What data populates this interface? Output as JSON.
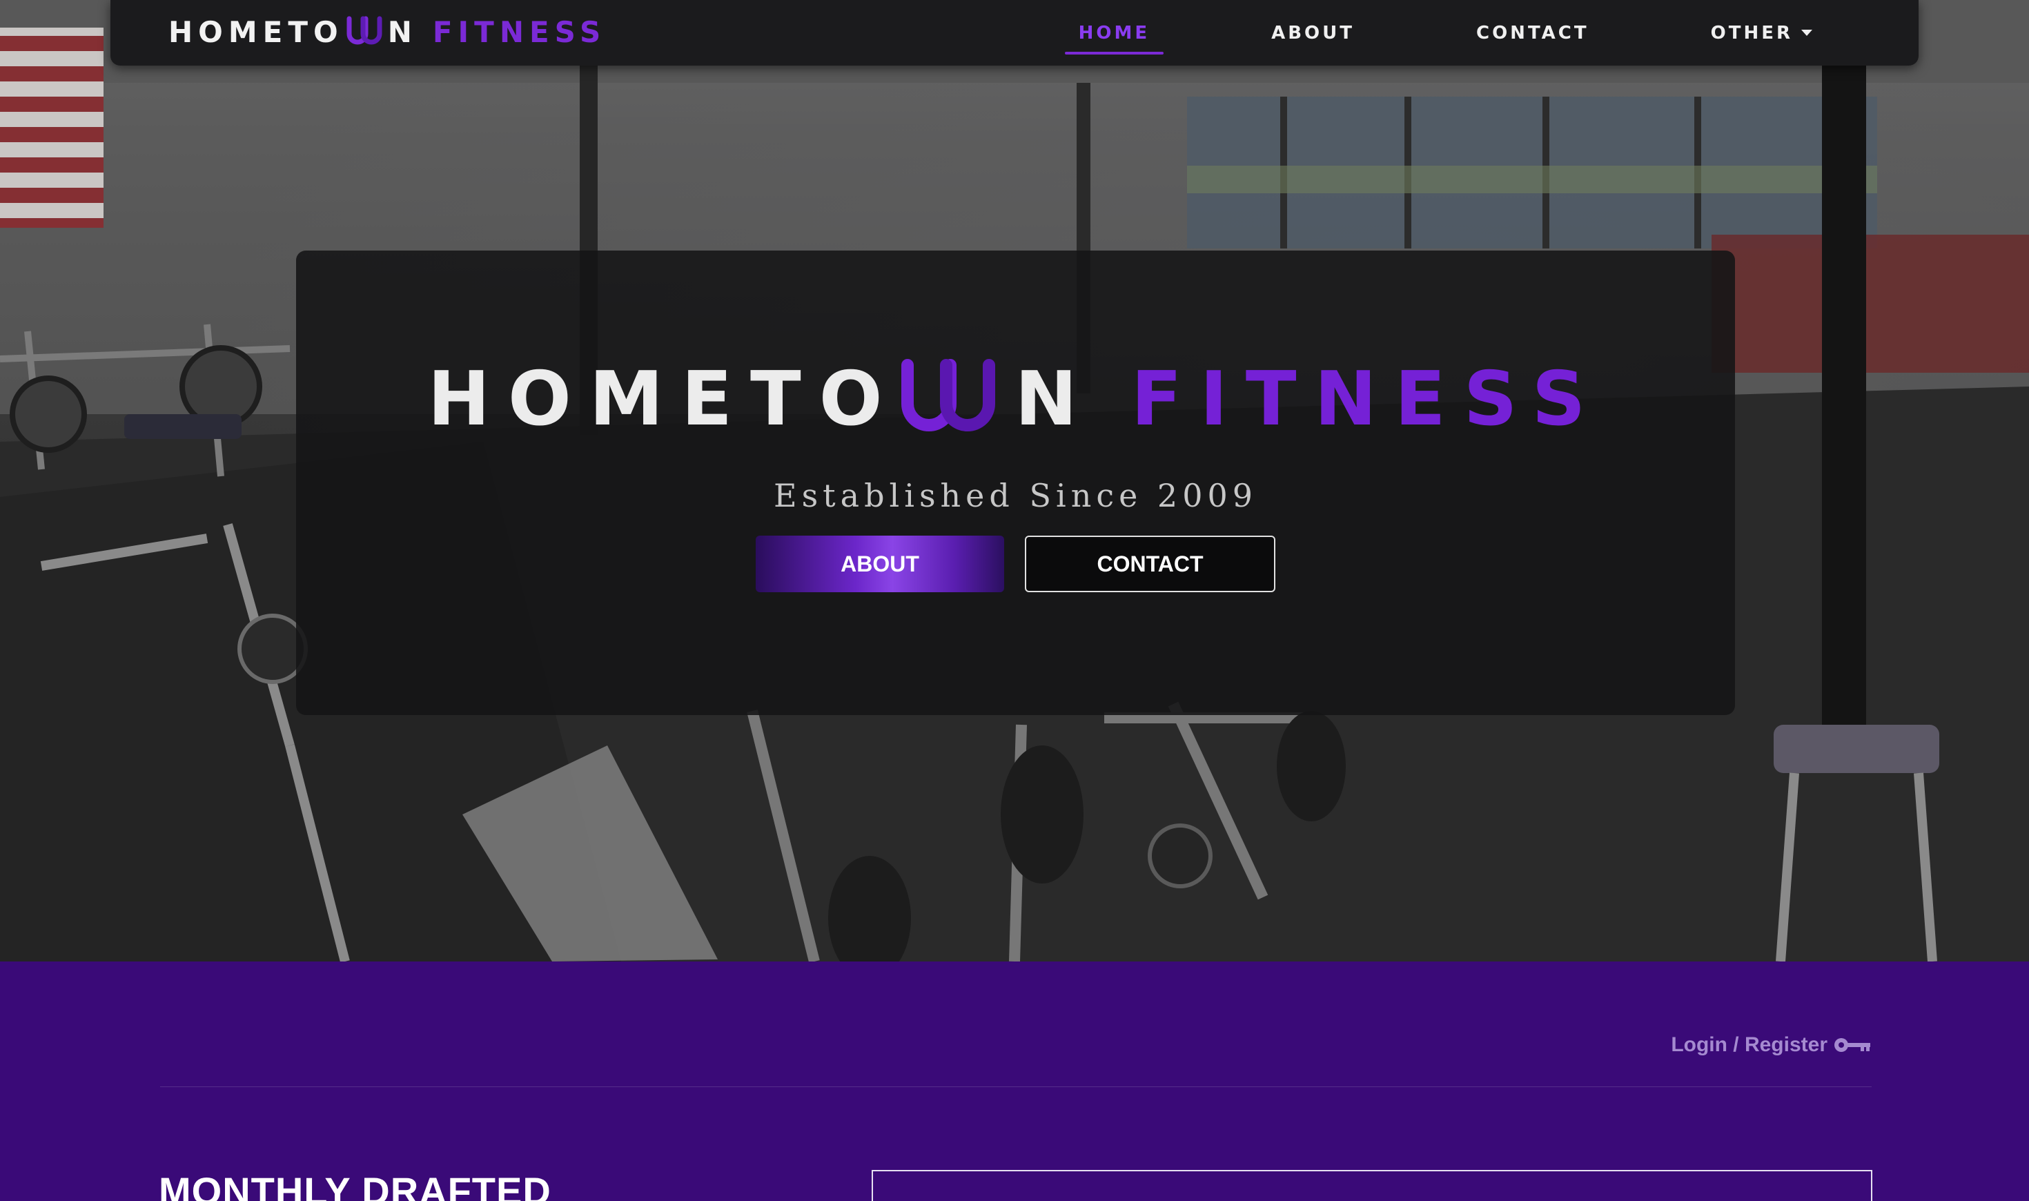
{
  "brand": {
    "word1_a": "HOMETO",
    "word1_b": "N",
    "word2": "FITNESS",
    "logo_icon": "horseshoes-icon"
  },
  "nav": {
    "items": [
      {
        "label": "HOME",
        "active": true
      },
      {
        "label": "ABOUT",
        "active": false
      },
      {
        "label": "CONTACT",
        "active": false
      },
      {
        "label": "OTHER",
        "active": false,
        "dropdown": true
      }
    ]
  },
  "hero": {
    "title_a": "HOMETO",
    "title_b": "N",
    "title_purple": "FITNESS",
    "tagline": "Established Since 2009",
    "primary_button": "ABOUT",
    "secondary_button": "CONTACT",
    "background": "gym-interior-photo"
  },
  "section": {
    "login_label": "Login / Register",
    "login_icon": "key-icon",
    "heading": "MONTHLY DRAFTED"
  },
  "colors": {
    "accent_purple": "#7521d6",
    "section_bg": "#3a0a78",
    "navbar_bg": "#1b1b1d",
    "login_text": "#a58ad0"
  }
}
